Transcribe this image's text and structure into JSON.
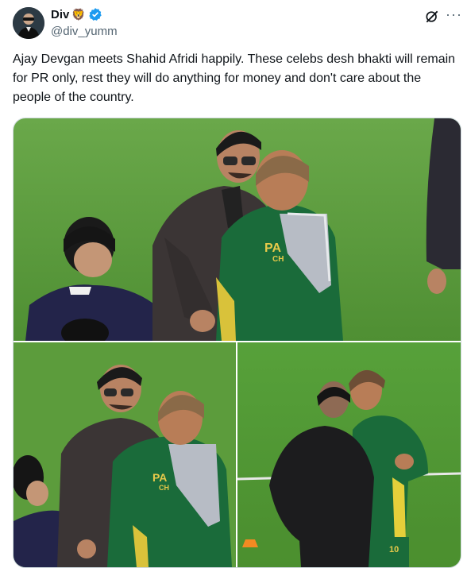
{
  "author": {
    "name": "Div",
    "name_emoji": "🦁",
    "handle": "@div_yumm",
    "verified": true
  },
  "tweet": {
    "text": "Ajay Devgan meets Shahid Afridi happily. These celebs desh bhakti will remain for PR only, rest they will do anything for money and don't care about the people of the country."
  },
  "media": {
    "top_jersey_text_1": "PA",
    "top_jersey_text_2": "CH",
    "left_jersey_text_1": "PA",
    "left_jersey_text_2": "CH",
    "right_jersey_number": "10"
  },
  "icons": {
    "verified": "verified-badge-icon",
    "grok": "grok-icon",
    "more": "more-options-icon"
  },
  "colors": {
    "verified_blue": "#1d9bf0",
    "handle_gray": "#536471",
    "grass": "#5a9a3a",
    "jersey_green": "#1a6b3a"
  },
  "more_label": "···"
}
